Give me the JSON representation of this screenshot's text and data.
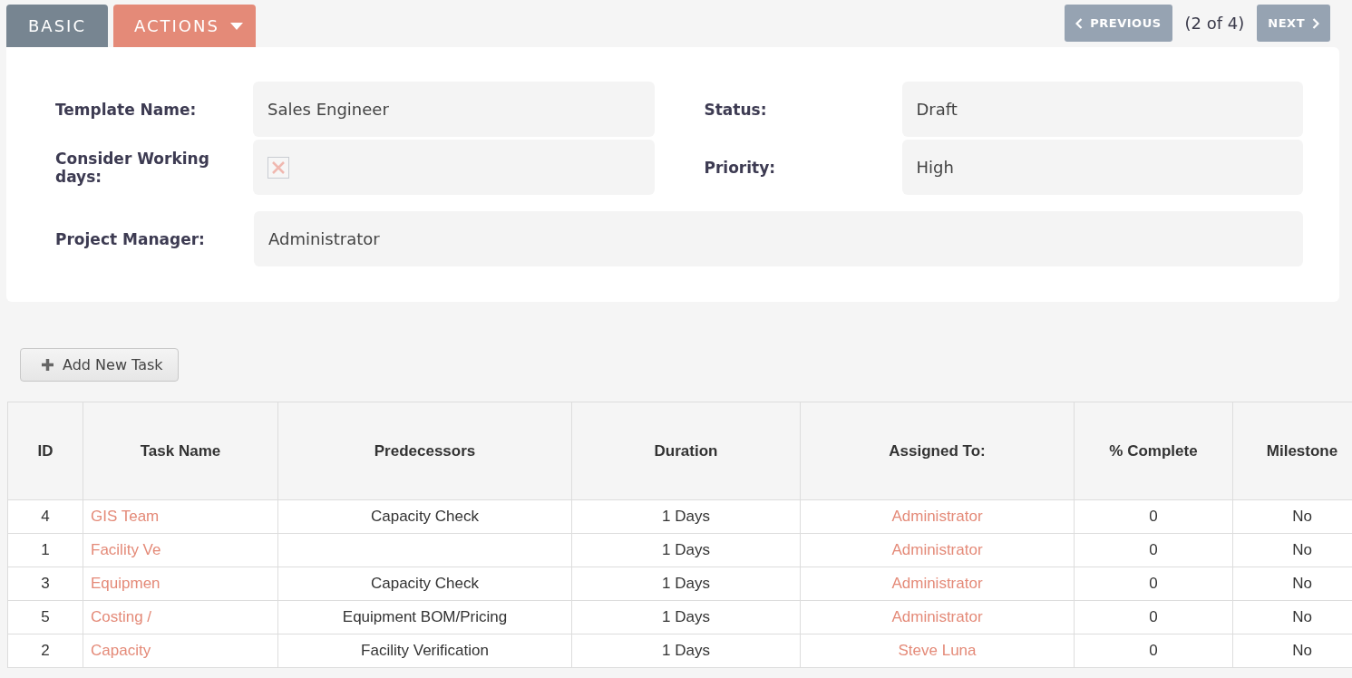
{
  "tabs": [
    {
      "label": "BASIC",
      "kind": "plain"
    },
    {
      "label": "ACTIONS",
      "kind": "dropdown"
    }
  ],
  "pager": {
    "previous": "PREVIOUS",
    "position": "(2 of 4)",
    "next": "NEXT"
  },
  "fields": [
    {
      "label": "Template Name:",
      "value": "Sales Engineer",
      "kind": "text"
    },
    {
      "label": "Status:",
      "value": "Draft",
      "kind": "text"
    },
    {
      "label": "Consider Working days:",
      "checked": false,
      "kind": "checkbox"
    },
    {
      "label": "Priority:",
      "value": "High",
      "kind": "text"
    },
    {
      "label": "Project Manager:",
      "value": "Administrator",
      "kind": "wide"
    }
  ],
  "add_button": "Add New Task",
  "table": {
    "columns": [
      "ID",
      "Task Name",
      "Predecessors",
      "Duration",
      "Assigned To:",
      "% Complete",
      "Milestone"
    ],
    "rows": [
      [
        "4",
        "GIS Team",
        "Capacity Check",
        "1 Days",
        "Administrator",
        "0",
        "No"
      ],
      [
        "1",
        "Facility Ve",
        "",
        "1 Days",
        "Administrator",
        "0",
        "No"
      ],
      [
        "3",
        "Equipmen",
        "Capacity Check",
        "1 Days",
        "Administrator",
        "0",
        "No"
      ],
      [
        "5",
        "Costing /",
        "Equipment BOM/Pricing",
        "1 Days",
        "Administrator",
        "0",
        "No"
      ],
      [
        "2",
        "Capacity",
        "Facility Verification",
        "1 Days",
        "Steve Luna",
        "0",
        "No"
      ]
    ]
  }
}
